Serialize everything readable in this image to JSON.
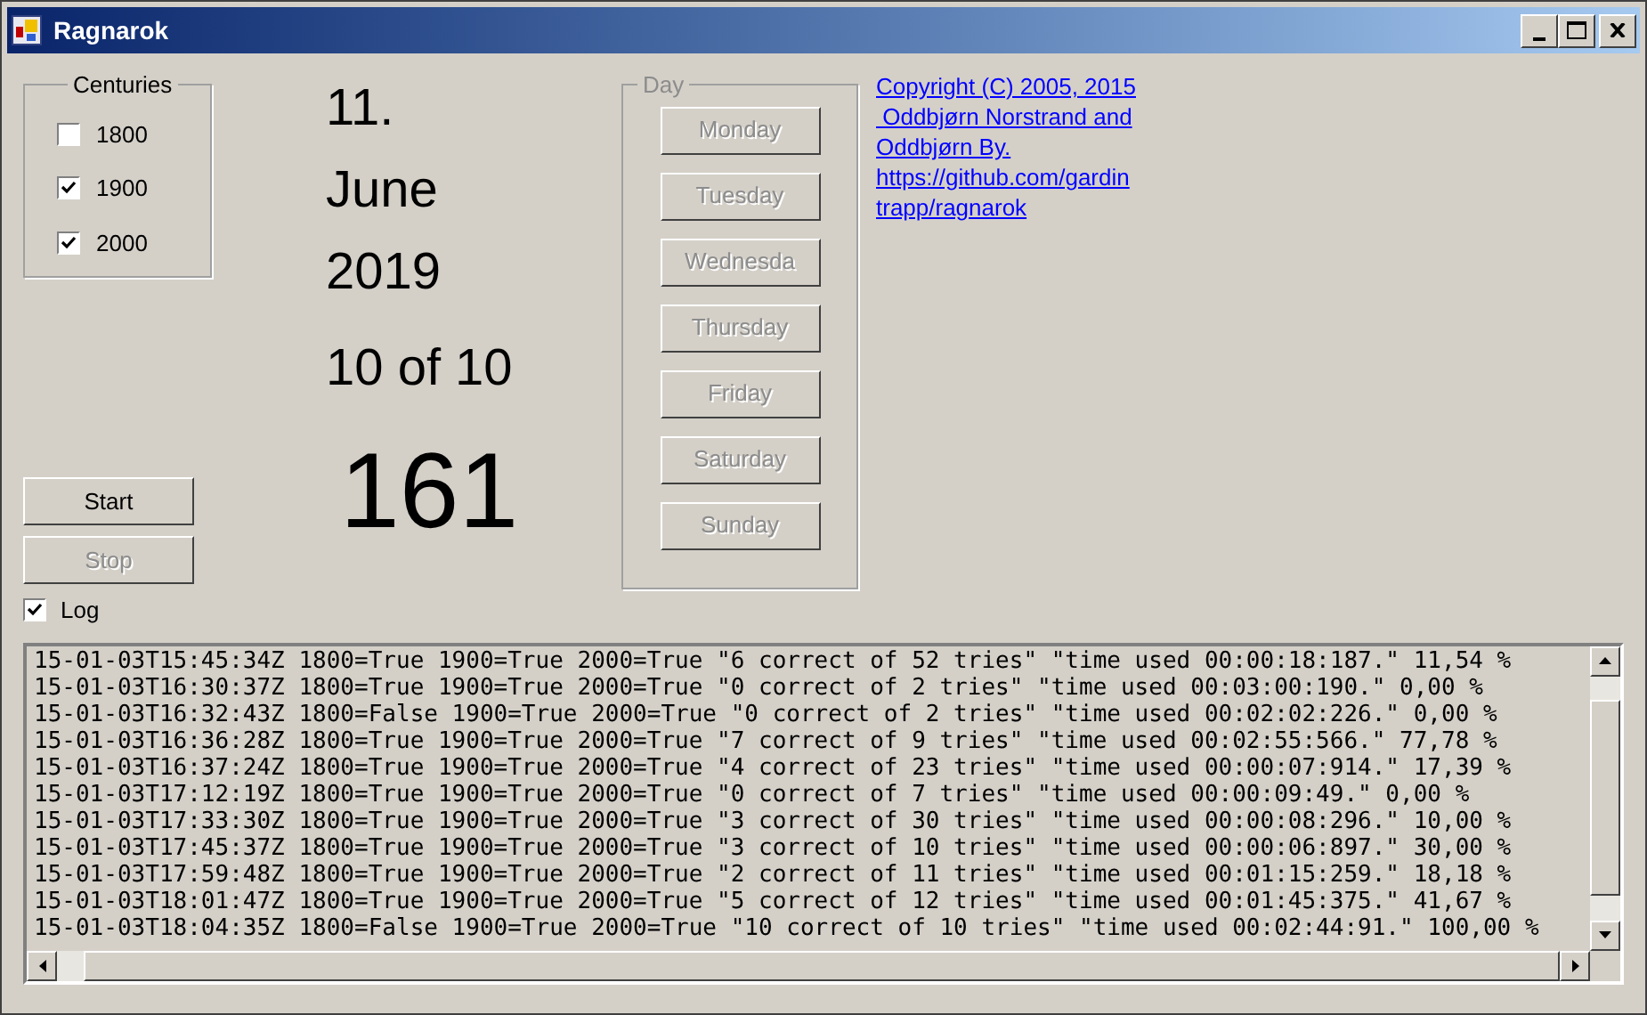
{
  "window": {
    "title": "Ragnarok"
  },
  "centuries": {
    "label": "Centuries",
    "items": [
      {
        "label": "1800",
        "checked": false
      },
      {
        "label": "1900",
        "checked": true
      },
      {
        "label": "2000",
        "checked": true
      }
    ]
  },
  "date": {
    "day": "11.",
    "month": "June",
    "year": "2019",
    "score": "10 of 10",
    "counter": "161"
  },
  "controls": [
    {
      "label": "Start",
      "disabled": false
    },
    {
      "label": "Stop",
      "disabled": true
    }
  ],
  "day_group": {
    "label": "Day",
    "buttons": [
      {
        "label": "Monday",
        "disabled": true
      },
      {
        "label": "Tuesday",
        "disabled": true
      },
      {
        "label": "Wednesda",
        "disabled": true
      },
      {
        "label": "Thursday",
        "disabled": true
      },
      {
        "label": "Friday",
        "disabled": true
      },
      {
        "label": "Saturday",
        "disabled": true
      },
      {
        "label": "Sunday",
        "disabled": true
      }
    ]
  },
  "copyright_link": {
    "lines": [
      "Copyright (C) 2005, 2015",
      " Oddbjørn Norstrand and",
      "Oddbjørn By.",
      "https://github.com/gardin",
      "trapp/ragnarok"
    ]
  },
  "log_option": {
    "label": "Log",
    "checked": true
  },
  "log_lines": [
    "15-01-03T15:45:34Z 1800=True 1900=True 2000=True \"6 correct of 52 tries\" \"time used 00:00:18:187.\" 11,54 %",
    "15-01-03T16:30:37Z 1800=True 1900=True 2000=True \"0 correct of 2 tries\" \"time used 00:03:00:190.\" 0,00 %",
    "15-01-03T16:32:43Z 1800=False 1900=True 2000=True \"0 correct of 2 tries\" \"time used 00:02:02:226.\" 0,00 %",
    "15-01-03T16:36:28Z 1800=True 1900=True 2000=True \"7 correct of 9 tries\" \"time used 00:02:55:566.\" 77,78 %",
    "15-01-03T16:37:24Z 1800=True 1900=True 2000=True \"4 correct of 23 tries\" \"time used 00:00:07:914.\" 17,39 %",
    "15-01-03T17:12:19Z 1800=True 1900=True 2000=True \"0 correct of 7 tries\" \"time used 00:00:09:49.\" 0,00 %",
    "15-01-03T17:33:30Z 1800=True 1900=True 2000=True \"3 correct of 30 tries\" \"time used 00:00:08:296.\" 10,00 %",
    "15-01-03T17:45:37Z 1800=True 1900=True 2000=True \"3 correct of 10 tries\" \"time used 00:00:06:897.\" 30,00 %",
    "15-01-03T17:59:48Z 1800=True 1900=True 2000=True \"2 correct of 11 tries\" \"time used 00:01:15:259.\" 18,18 %",
    "15-01-03T18:01:47Z 1800=True 1900=True 2000=True \"5 correct of 12 tries\" \"time used 00:01:45:375.\" 41,67 %",
    "15-01-03T18:04:35Z 1800=False 1900=True 2000=True \"10 correct of 10 tries\" \"time used 00:02:44:91.\" 100,00 %"
  ]
}
